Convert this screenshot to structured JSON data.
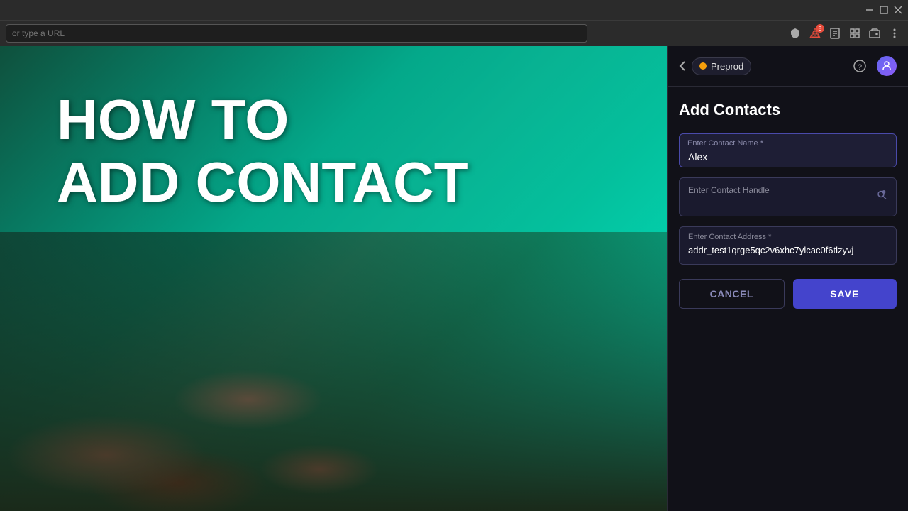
{
  "browser": {
    "url_placeholder": "or type a URL",
    "title_bar_buttons": [
      "minimize",
      "maximize",
      "close"
    ],
    "nav_badge_count": "8"
  },
  "overlay": {
    "line1": "HOW TO",
    "line2": "ADD CONTACT"
  },
  "panel": {
    "back_label": "‹",
    "network_label": "Preprod",
    "help_icon": "?",
    "avatar_icon": "🏃",
    "title": "Add Contacts",
    "form": {
      "name_label": "Enter Contact Name *",
      "name_value": "Alex",
      "handle_label": "Enter Contact Handle",
      "handle_placeholder": "Enter Contact Handle",
      "handle_value": "",
      "address_label": "Enter Contact Address *",
      "address_value": "addr_test1qrge5qc2v6xhc7ylcac0f6tlzyvj"
    },
    "cancel_label": "CANCEL",
    "save_label": "SAVE"
  }
}
